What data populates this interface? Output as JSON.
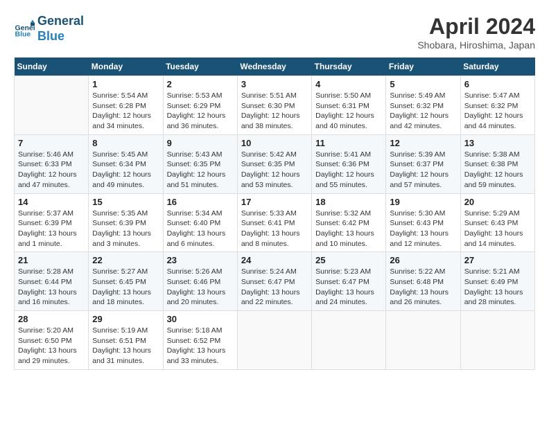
{
  "header": {
    "logo_line1": "General",
    "logo_line2": "Blue",
    "month_title": "April 2024",
    "subtitle": "Shobara, Hiroshima, Japan"
  },
  "weekdays": [
    "Sunday",
    "Monday",
    "Tuesday",
    "Wednesday",
    "Thursday",
    "Friday",
    "Saturday"
  ],
  "weeks": [
    [
      {
        "day": "",
        "info": ""
      },
      {
        "day": "1",
        "info": "Sunrise: 5:54 AM\nSunset: 6:28 PM\nDaylight: 12 hours\nand 34 minutes."
      },
      {
        "day": "2",
        "info": "Sunrise: 5:53 AM\nSunset: 6:29 PM\nDaylight: 12 hours\nand 36 minutes."
      },
      {
        "day": "3",
        "info": "Sunrise: 5:51 AM\nSunset: 6:30 PM\nDaylight: 12 hours\nand 38 minutes."
      },
      {
        "day": "4",
        "info": "Sunrise: 5:50 AM\nSunset: 6:31 PM\nDaylight: 12 hours\nand 40 minutes."
      },
      {
        "day": "5",
        "info": "Sunrise: 5:49 AM\nSunset: 6:32 PM\nDaylight: 12 hours\nand 42 minutes."
      },
      {
        "day": "6",
        "info": "Sunrise: 5:47 AM\nSunset: 6:32 PM\nDaylight: 12 hours\nand 44 minutes."
      }
    ],
    [
      {
        "day": "7",
        "info": "Sunrise: 5:46 AM\nSunset: 6:33 PM\nDaylight: 12 hours\nand 47 minutes."
      },
      {
        "day": "8",
        "info": "Sunrise: 5:45 AM\nSunset: 6:34 PM\nDaylight: 12 hours\nand 49 minutes."
      },
      {
        "day": "9",
        "info": "Sunrise: 5:43 AM\nSunset: 6:35 PM\nDaylight: 12 hours\nand 51 minutes."
      },
      {
        "day": "10",
        "info": "Sunrise: 5:42 AM\nSunset: 6:35 PM\nDaylight: 12 hours\nand 53 minutes."
      },
      {
        "day": "11",
        "info": "Sunrise: 5:41 AM\nSunset: 6:36 PM\nDaylight: 12 hours\nand 55 minutes."
      },
      {
        "day": "12",
        "info": "Sunrise: 5:39 AM\nSunset: 6:37 PM\nDaylight: 12 hours\nand 57 minutes."
      },
      {
        "day": "13",
        "info": "Sunrise: 5:38 AM\nSunset: 6:38 PM\nDaylight: 12 hours\nand 59 minutes."
      }
    ],
    [
      {
        "day": "14",
        "info": "Sunrise: 5:37 AM\nSunset: 6:39 PM\nDaylight: 13 hours\nand 1 minute."
      },
      {
        "day": "15",
        "info": "Sunrise: 5:35 AM\nSunset: 6:39 PM\nDaylight: 13 hours\nand 3 minutes."
      },
      {
        "day": "16",
        "info": "Sunrise: 5:34 AM\nSunset: 6:40 PM\nDaylight: 13 hours\nand 6 minutes."
      },
      {
        "day": "17",
        "info": "Sunrise: 5:33 AM\nSunset: 6:41 PM\nDaylight: 13 hours\nand 8 minutes."
      },
      {
        "day": "18",
        "info": "Sunrise: 5:32 AM\nSunset: 6:42 PM\nDaylight: 13 hours\nand 10 minutes."
      },
      {
        "day": "19",
        "info": "Sunrise: 5:30 AM\nSunset: 6:43 PM\nDaylight: 13 hours\nand 12 minutes."
      },
      {
        "day": "20",
        "info": "Sunrise: 5:29 AM\nSunset: 6:43 PM\nDaylight: 13 hours\nand 14 minutes."
      }
    ],
    [
      {
        "day": "21",
        "info": "Sunrise: 5:28 AM\nSunset: 6:44 PM\nDaylight: 13 hours\nand 16 minutes."
      },
      {
        "day": "22",
        "info": "Sunrise: 5:27 AM\nSunset: 6:45 PM\nDaylight: 13 hours\nand 18 minutes."
      },
      {
        "day": "23",
        "info": "Sunrise: 5:26 AM\nSunset: 6:46 PM\nDaylight: 13 hours\nand 20 minutes."
      },
      {
        "day": "24",
        "info": "Sunrise: 5:24 AM\nSunset: 6:47 PM\nDaylight: 13 hours\nand 22 minutes."
      },
      {
        "day": "25",
        "info": "Sunrise: 5:23 AM\nSunset: 6:47 PM\nDaylight: 13 hours\nand 24 minutes."
      },
      {
        "day": "26",
        "info": "Sunrise: 5:22 AM\nSunset: 6:48 PM\nDaylight: 13 hours\nand 26 minutes."
      },
      {
        "day": "27",
        "info": "Sunrise: 5:21 AM\nSunset: 6:49 PM\nDaylight: 13 hours\nand 28 minutes."
      }
    ],
    [
      {
        "day": "28",
        "info": "Sunrise: 5:20 AM\nSunset: 6:50 PM\nDaylight: 13 hours\nand 29 minutes."
      },
      {
        "day": "29",
        "info": "Sunrise: 5:19 AM\nSunset: 6:51 PM\nDaylight: 13 hours\nand 31 minutes."
      },
      {
        "day": "30",
        "info": "Sunrise: 5:18 AM\nSunset: 6:52 PM\nDaylight: 13 hours\nand 33 minutes."
      },
      {
        "day": "",
        "info": ""
      },
      {
        "day": "",
        "info": ""
      },
      {
        "day": "",
        "info": ""
      },
      {
        "day": "",
        "info": ""
      }
    ]
  ]
}
